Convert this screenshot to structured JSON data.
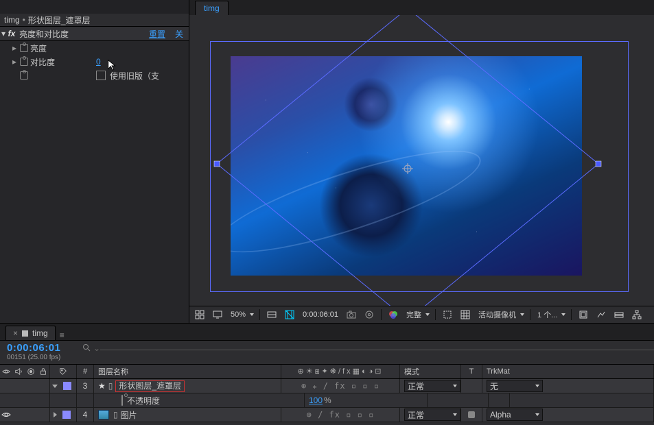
{
  "fx": {
    "breadcrumb_comp": "timg",
    "breadcrumb_layer": "形状图层_遮罩层",
    "effect_name": "亮度和对比度",
    "reset_label": "重置",
    "close_label": "关",
    "params": {
      "brightness": {
        "label": "亮度"
      },
      "contrast": {
        "label": "对比度",
        "value": "0"
      },
      "legacy": {
        "label": "使用旧版（支"
      }
    }
  },
  "viewer": {
    "tab_label": "timg",
    "toolbar": {
      "zoom": "50%",
      "timecode": "0:00:06:01",
      "resolution": "完整",
      "camera": "活动摄像机",
      "views": "1 个..."
    }
  },
  "timeline": {
    "tab": {
      "label": "timg"
    },
    "current_time": "0:00:06:01",
    "frame_info": "00151 (25.00 fps)",
    "search_placeholder": "",
    "headers": {
      "index": "#",
      "name": "图层名称",
      "mode": "模式",
      "t": "T",
      "trkmat": "TrkMat"
    },
    "layers": [
      {
        "index": "3",
        "name": "形状图层_遮罩层",
        "swatch": "#8a8aff",
        "switches": "⊕ ⁎ / fx",
        "mode": "正常",
        "trkmat": "无",
        "eye": false,
        "open": true
      },
      {
        "sub": true,
        "name": "不透明度",
        "value": "100",
        "pct": "%"
      },
      {
        "index": "4",
        "name": "图片",
        "swatch": "#8a8aff",
        "switches": "⊕   / fx",
        "mode": "正常",
        "trkmat": "Alpha",
        "eye": true,
        "open": false
      }
    ]
  }
}
